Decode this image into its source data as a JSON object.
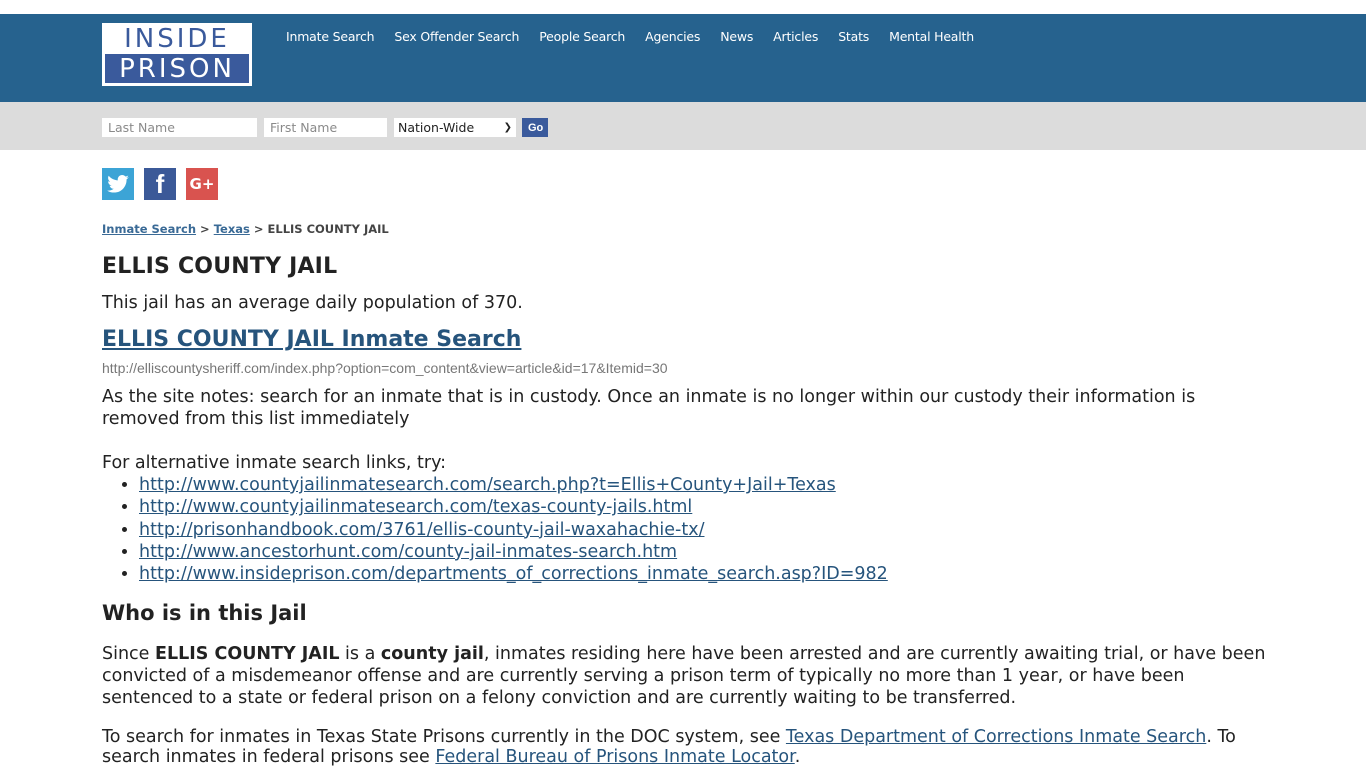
{
  "logo": {
    "top": "INSIDE",
    "bottom": "PRISON"
  },
  "nav": [
    {
      "label": "Inmate Search"
    },
    {
      "label": "Sex Offender Search"
    },
    {
      "label": "People Search"
    },
    {
      "label": "Agencies"
    },
    {
      "label": "News"
    },
    {
      "label": "Articles"
    },
    {
      "label": "Stats"
    },
    {
      "label": "Mental Health"
    }
  ],
  "search": {
    "last_name_placeholder": "Last Name",
    "first_name_placeholder": "First Name",
    "scope_selected": "Nation-Wide",
    "go_label": "Go"
  },
  "social": {
    "twitter": "twitter-icon",
    "facebook": "facebook-icon",
    "google_plus": "google-plus-icon"
  },
  "breadcrumb": {
    "item1": "Inmate Search",
    "sep": ">",
    "item2": "Texas",
    "current": "ELLIS COUNTY JAIL"
  },
  "page": {
    "title": "ELLIS COUNTY JAIL",
    "population_text": "This jail has an average daily population of 370.",
    "search_link": "ELLIS COUNTY JAIL Inmate Search",
    "search_url": "http://elliscountysheriff.com/index.php?option=com_content&view=article&id=17&Itemid=30",
    "site_note": "As the site notes: search for an inmate that is in custody. Once an inmate is no longer within our custody their information is removed from this list immediately",
    "alt_intro": "For alternative inmate search links, try:",
    "alt_links": [
      "http://www.countyjailinmatesearch.com/search.php?t=Ellis+County+Jail+Texas",
      "http://www.countyjailinmatesearch.com/texas-county-jails.html",
      "http://prisonhandbook.com/3761/ellis-county-jail-waxahachie-tx/",
      "http://www.ancestorhunt.com/county-jail-inmates-search.htm",
      "http://www.insideprison.com/departments_of_corrections_inmate_search.asp?ID=982"
    ],
    "who_heading": "Who is in this Jail",
    "who_p1": "Since ",
    "who_b1": "ELLIS COUNTY JAIL",
    "who_p2": " is a ",
    "who_b2": "county jail",
    "who_p3": ", inmates residing here have been arrested and are currently awaiting trial, or have been convicted of a misdemeanor offense and are currently serving a prison term of typically no more than 1 year, or have been sentenced to a state or federal prison on a felony conviction and are currently waiting to be transferred.",
    "doc_p1": "To search for inmates in Texas State Prisons currently in the DOC system, see ",
    "doc_link1": "Texas Department of Corrections Inmate Search",
    "doc_p2": ". To search inmates in federal prisons see ",
    "doc_link2": "Federal Bureau of Prisons Inmate Locator",
    "doc_p3": "."
  }
}
